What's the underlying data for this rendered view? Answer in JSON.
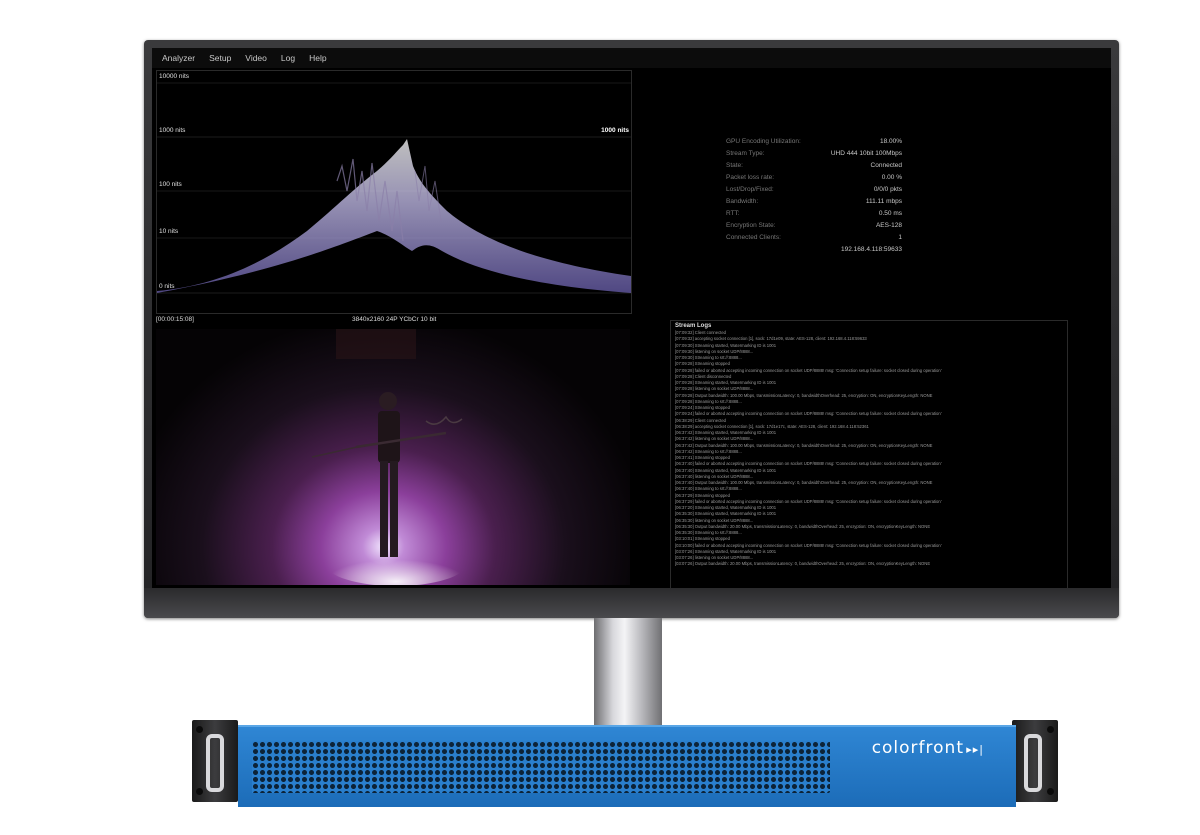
{
  "menu": [
    "Analyzer",
    "Setup",
    "Video",
    "Log",
    "Help"
  ],
  "waveform": {
    "labels": [
      "10000 nits",
      "1000 nits",
      "100 nits",
      "10 nits",
      "0 nits"
    ],
    "right_label": "1000 nits",
    "timecode": "[00:00:15:08]",
    "format": "3840x2160 24P YCbCr 10 bit"
  },
  "stats": [
    {
      "label": "GPU Encoding Utilization:",
      "value": "18.00%"
    },
    {
      "label": "Stream Type:",
      "value": "UHD 444 10bit 100Mbps"
    },
    {
      "label": "State:",
      "value": "Connected"
    },
    {
      "label": "Packet loss rate:",
      "value": "0.00 %"
    },
    {
      "label": "Lost/Drop/Fixed:",
      "value": "0/0/0 pkts"
    },
    {
      "label": "Bandwidth:",
      "value": "111.11 mbps"
    },
    {
      "label": "RTT:",
      "value": "0.50 ms"
    },
    {
      "label": "Encryption State:",
      "value": "AES-128"
    },
    {
      "label": "Connected Clients:",
      "value": "1"
    },
    {
      "label": "",
      "value": "192.168.4.118:59633"
    }
  ],
  "logs": {
    "title": "Stream Logs",
    "lines": [
      "[07:09:32] Client connected",
      "[07:09:32] accepting socket connection [1], sock: 17d1e09, state: AES-128, client: 192.168.4.118:59633",
      "[07:09:30] Streaming started, Watermarking ID is 1001",
      "[07:09:30] listening on socket UDP/8888...",
      "[07:09:30] Streaming to srt://:8888...",
      "[07:09:28] Streaming stopped",
      "[07:09:28] failed or aborted accepting incoming connection on socket UDP/8888! msg: 'Connection setup failure: socket closed during operation'",
      "[07:09:28] Client disconnected",
      "[07:09:28] Streaming started, Watermarking ID is 1001",
      "[07:09:28] listening on socket UDP/8888...",
      "[07:09:28]      Output bandwidth: 100.00 Mbps, transmissionLatency: 0, bandwidthOverhead: 25, encryption: ON, encryptionKeyLength: NONE",
      "[07:09:28] Streaming to srt://:8888...",
      "[07:09:24] Streaming stopped",
      "[07:09:24] failed or aborted accepting incoming connection on socket UDP/8888! msg: 'Connection setup failure: socket closed during operation'",
      "[06:38:29] Client connected",
      "[06:38:29] accepting socket connection [1], sock: 17d1e17c, state: AES-128, client: 192.168.4.118:52361",
      "[06:37:42] Streaming started, Watermarking ID is 1001",
      "[06:37:42] listening on socket UDP/8888...",
      "[06:37:42]      Output bandwidth: 100.00 Mbps, transmissionLatency: 0, bandwidthOverhead: 25, encryption: ON, encryptionKeyLength: NONE",
      "[06:37:42] Streaming to srt://:8888...",
      "[06:37:41] Streaming stopped",
      "[06:37:40] failed or aborted accepting incoming connection on socket UDP/8888! msg: 'Connection setup failure: socket closed during operation'",
      "[06:37:40] Streaming started, Watermarking ID is 1001",
      "[06:37:40] listening on socket UDP/8888...",
      "[06:37:40]      Output bandwidth: 100.00 Mbps, transmissionLatency: 0, bandwidthOverhead: 25, encryption: ON, encryptionKeyLength: NONE",
      "[06:37:40] Streaming to srt://:8888...",
      "[06:37:29] Streaming stopped",
      "[06:37:29] failed or aborted accepting incoming connection on socket UDP/8888! msg: 'Connection setup failure: socket closed during operation'",
      "[06:37:20] Streaming started, Watermarking ID is 1001",
      "[06:35:30] Streaming started, Watermarking ID is 1001",
      "[06:35:30] listening on socket UDP/8888...",
      "[06:35:30]      Output bandwidth: 20.00 Mbps, transmissionLatency: 0, bandwidthOverhead: 25, encryption: ON, encryptionKeyLength: NONE",
      "[06:35:30] Streaming to srt://:8888...",
      "[03:10:01] Streaming stopped",
      "[03:10:00] failed or aborted accepting incoming connection on socket UDP/8888! msg: 'Connection setup failure: socket closed during operation'",
      "[03:07:26] Streaming started, Watermarking ID is 1001",
      "[03:07:26] listening on socket UDP/8888...",
      "[03:07:26]      Output bandwidth: 20.00 Mbps, transmissionLatency: 0, bandwidthOverhead: 25, encryption: ON, encryptionKeyLength: NONE"
    ]
  },
  "brand": "colorfront",
  "colors": {
    "rack_blue": "#2a7fcd",
    "waveform_tone": "#b9b0e8"
  }
}
